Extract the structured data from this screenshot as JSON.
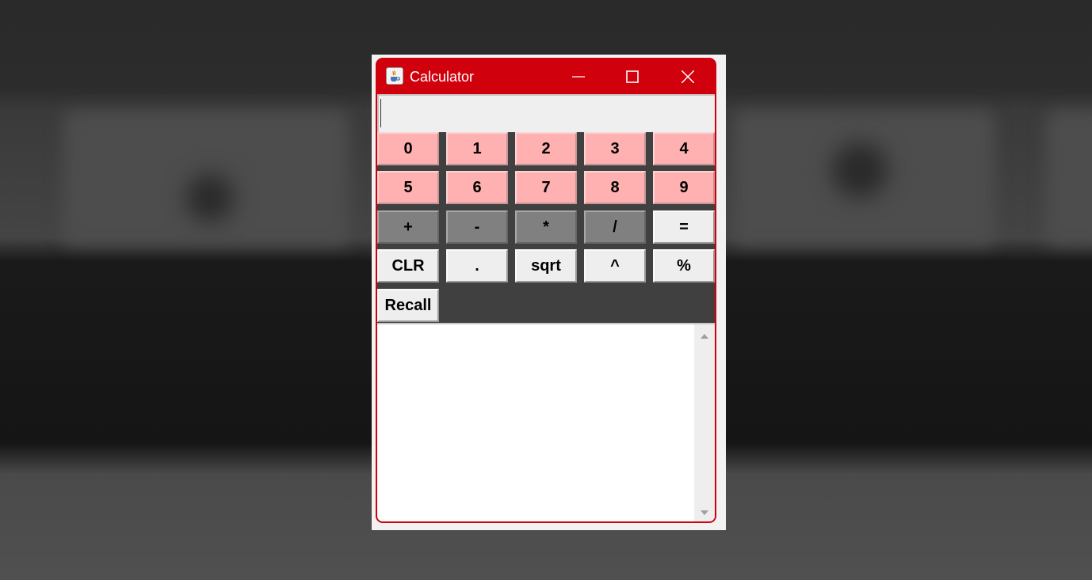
{
  "window": {
    "title": "Calculator",
    "accent_color": "#d0000c",
    "icons": [
      "java-cup-icon",
      "minimize-icon",
      "maximize-icon",
      "close-icon"
    ]
  },
  "display": {
    "value": ""
  },
  "keys": {
    "row1": [
      "0",
      "1",
      "2",
      "3",
      "4"
    ],
    "row2": [
      "5",
      "6",
      "7",
      "8",
      "9"
    ],
    "row3": [
      "+",
      "-",
      "*",
      "/",
      "="
    ],
    "row4": [
      "CLR",
      ".",
      "sqrt",
      "^",
      "%"
    ],
    "row5": [
      "Recall"
    ]
  },
  "colors": {
    "digit_key": "#ffb0b0",
    "operator_key": "#808080",
    "function_key": "#eeeeee"
  },
  "history": {
    "text": ""
  }
}
